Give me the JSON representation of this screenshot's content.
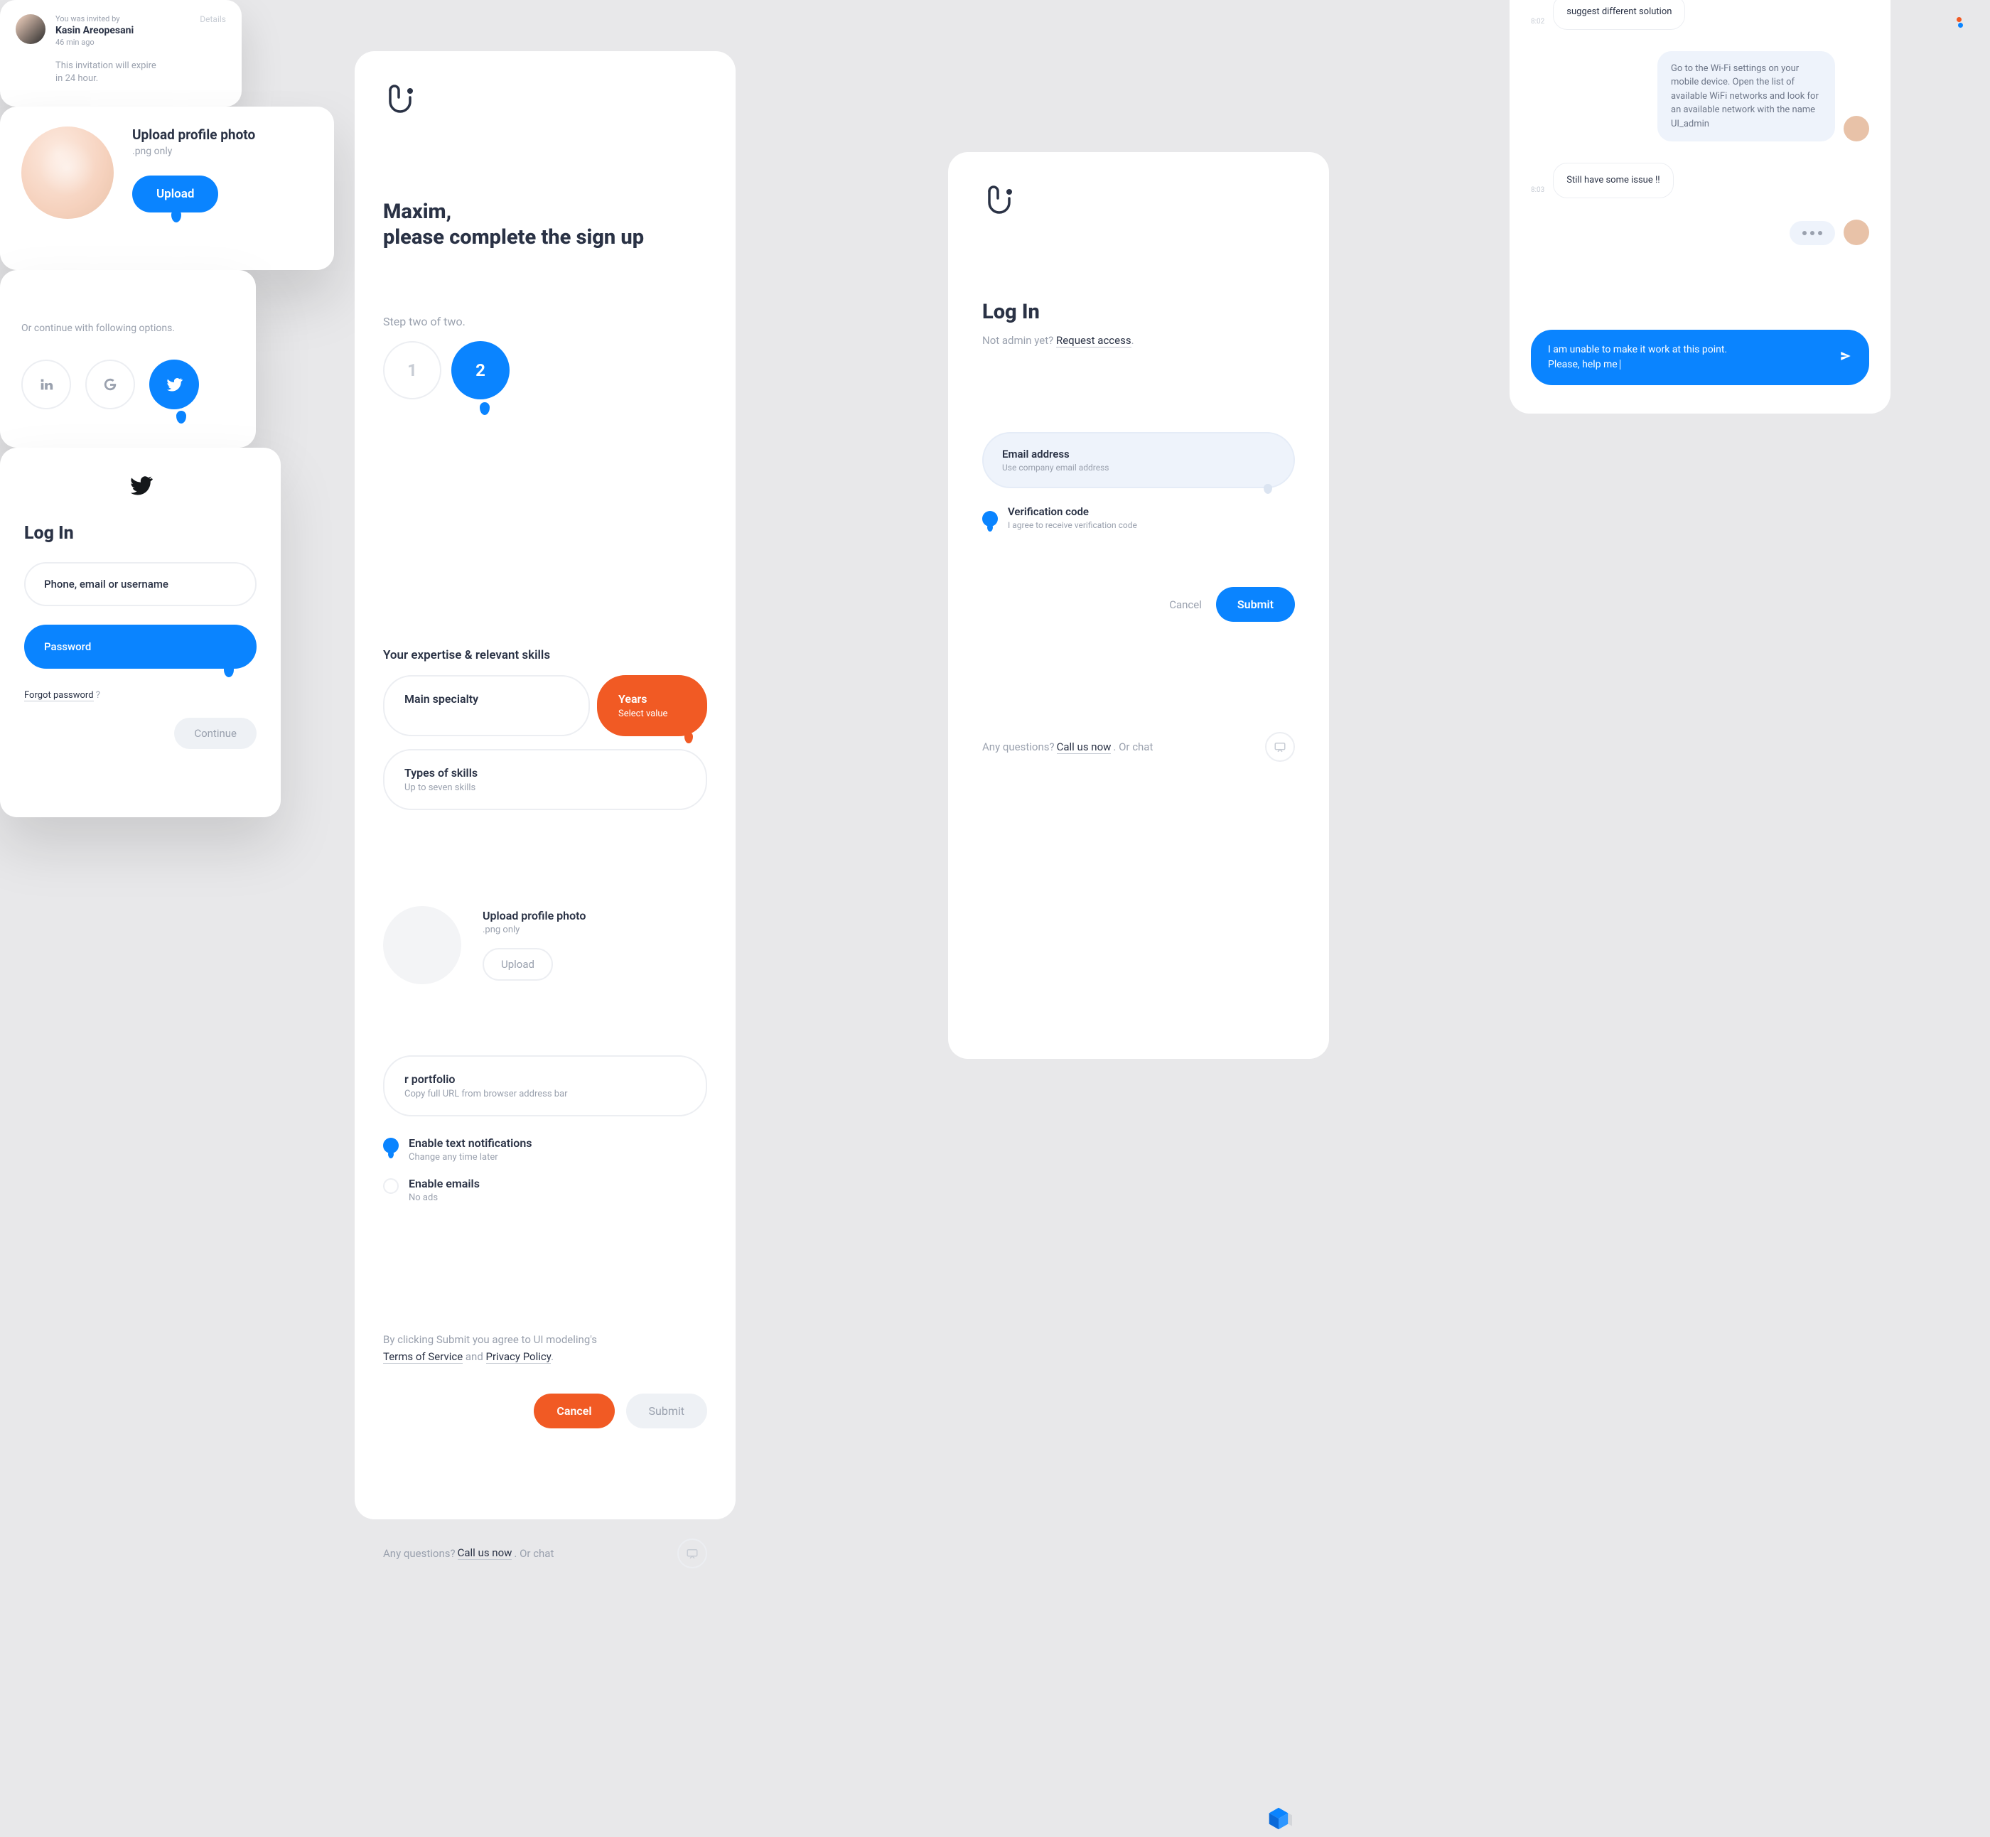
{
  "signup": {
    "title_line1": "Maxim,",
    "title_line2": "please complete the sign up",
    "step_label": "Step two of two.",
    "step1": "1",
    "step2": "2",
    "invite": {
      "inv": "You was invited by",
      "name": "Kasin Areopesani",
      "time": "46 min ago",
      "expire1": "This invitation will expire",
      "expire2": "in 24 hour.",
      "details": "Details"
    },
    "expertise": {
      "title": "Your expertise & relevant skills",
      "specialty": "Main specialty",
      "years": "Years",
      "years_sub": "Select value",
      "skills": "Types of skills",
      "skills_sub": "Up to seven skills"
    },
    "upload": {
      "title": "Upload profile photo",
      "sub": ".png only",
      "btn": "Upload"
    },
    "upload_overlay": {
      "title": "Upload profile photo",
      "sub": ".png only",
      "btn": "Upload"
    },
    "portfolio": {
      "title": "r portfolio",
      "sub": "Copy full URL from browser address bar"
    },
    "notify_text": {
      "t": "Enable text notifications",
      "s": "Change any time later"
    },
    "notify_email": {
      "t": "Enable emails",
      "s": "No ads"
    },
    "legal": {
      "pre": "By clicking Submit you agree to UI modeling's",
      "tos": "Terms of Service",
      "and": " and ",
      "pp": "Privacy Policy",
      "dot": "."
    },
    "cancel": "Cancel",
    "submit": "Submit",
    "footer": {
      "q": "Any questions? ",
      "call": "Call us now",
      "or": ". Or chat"
    }
  },
  "login": {
    "title": "Log In",
    "sub_pre": "Not admin yet? ",
    "sub_link": "Request access",
    "sub_dot": ".",
    "email": {
      "t": "Email address",
      "s": "Use company email address"
    },
    "code": {
      "t": "Verification code",
      "s": "I agree to receive verification code"
    },
    "cancel": "Cancel",
    "submit": "Submit",
    "footer": {
      "q": "Any questions? ",
      "call": "Call us now",
      "or": ". Or chat"
    }
  },
  "social": {
    "label": "Or continue with following options."
  },
  "twlogin": {
    "title": "Log In",
    "field1": "Phone, email or username",
    "field2": "Password",
    "forgot_link": "Forgot password",
    "forgot_q": " ?",
    "continue": "Continue"
  },
  "chat": {
    "t1": "8:02",
    "m1": "suggest different solution",
    "m2": "Go to the Wi-Fi settings on your mobile device. Open the list of available WiFi networks and look for an available network with the name UI_admin",
    "t2": "8:03",
    "m3": "Still have some issue !!",
    "input_l1": "I am unable to make it work at this point.",
    "input_l2": "Please, help me"
  }
}
